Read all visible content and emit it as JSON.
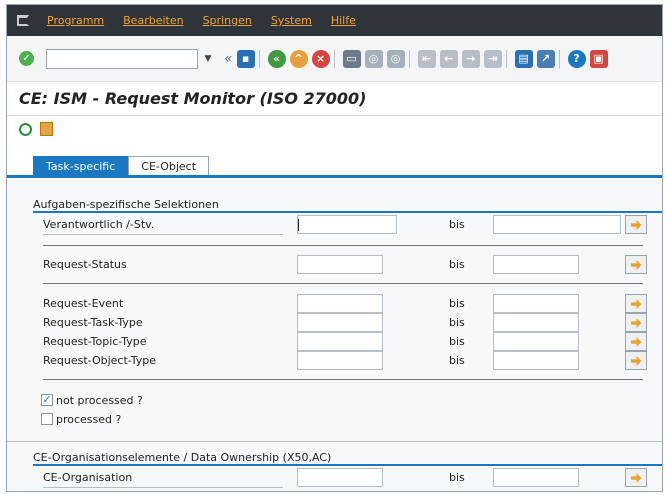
{
  "menu": [
    "Programm",
    "Bearbeiten",
    "Springen",
    "System",
    "Hilfe"
  ],
  "toolbar": {
    "command_value": "",
    "icons": [
      "ok-icon",
      "save-icon",
      "back-icon",
      "exit-icon",
      "cancel-icon",
      "print-icon",
      "find-icon",
      "find-next-icon",
      "first-page-icon",
      "prev-page-icon",
      "next-page-icon",
      "last-page-icon",
      "new-session-icon",
      "shortcut-icon",
      "help-icon",
      "layout-icon"
    ]
  },
  "title": "CE: ISM - Request Monitor (ISO 27000)",
  "tabs": [
    {
      "label": "Task-specific",
      "active": true
    },
    {
      "label": "CE-Object",
      "active": false
    }
  ],
  "group1": {
    "title": "Aufgaben-spezifische Selektionen",
    "rows": [
      {
        "label": "Verantwortlich /-Stv.",
        "from": "",
        "bis": "bis",
        "to": ""
      },
      {
        "label": "Request-Status",
        "from": "",
        "bis": "bis",
        "to": ""
      },
      {
        "label": "Request-Event",
        "from": "",
        "bis": "bis",
        "to": ""
      },
      {
        "label": "Request-Task-Type",
        "from": "",
        "bis": "bis",
        "to": ""
      },
      {
        "label": "Request-Topic-Type",
        "from": "",
        "bis": "bis",
        "to": ""
      },
      {
        "label": "Request-Object-Type",
        "from": "",
        "bis": "bis",
        "to": ""
      }
    ],
    "checkboxes": [
      {
        "label": "not processed ?",
        "checked": true
      },
      {
        "label": "processed ?",
        "checked": false
      }
    ]
  },
  "group2": {
    "title": "CE-Organisationselemente / Data Ownership (X50,AC)",
    "rows": [
      {
        "label": "CE-Organisation",
        "from": "",
        "bis": "bis",
        "to": ""
      }
    ]
  },
  "colors": {
    "accent": "#1a78c2",
    "menu_bg": "#2f333a",
    "menu_text": "#f0a53a",
    "multi_select_arrow": "#eba42b"
  }
}
